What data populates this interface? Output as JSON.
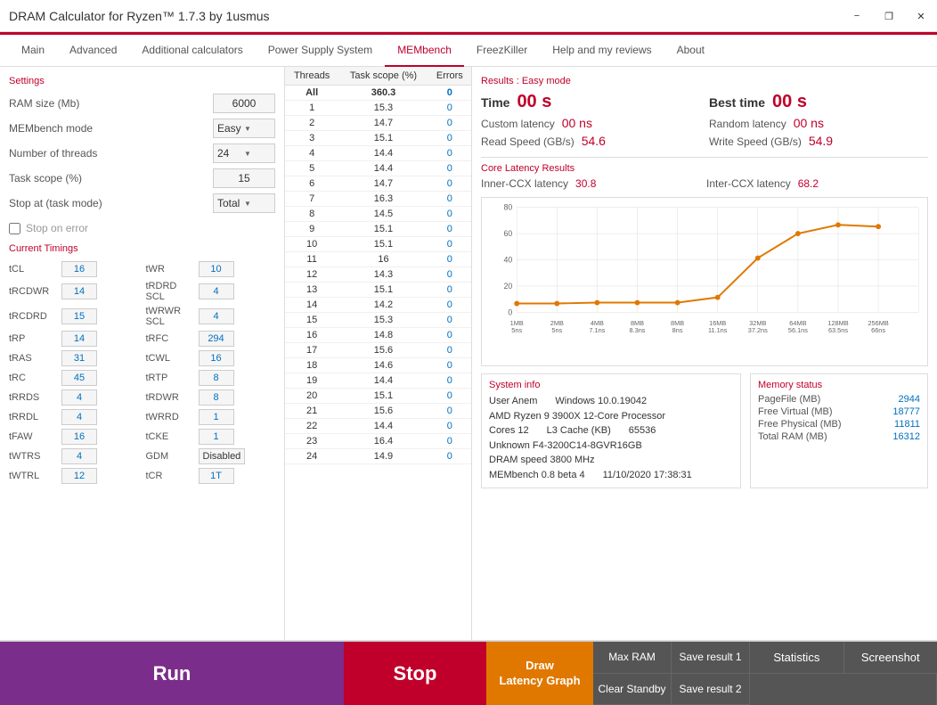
{
  "titlebar": {
    "title": "DRAM Calculator for Ryzen™ 1.7.3 by 1usmus",
    "min": "−",
    "restore": "❐",
    "close": "✕"
  },
  "nav": {
    "items": [
      {
        "label": "Main",
        "active": false
      },
      {
        "label": "Advanced",
        "active": false
      },
      {
        "label": "Additional calculators",
        "active": false
      },
      {
        "label": "Power Supply System",
        "active": false
      },
      {
        "label": "MEMbench",
        "active": true
      },
      {
        "label": "FreezKiller",
        "active": false
      },
      {
        "label": "Help and my reviews",
        "active": false
      },
      {
        "label": "About",
        "active": false
      }
    ]
  },
  "settings": {
    "label": "Settings",
    "ram_size_label": "RAM size (Mb)",
    "ram_size_val": "6000",
    "membench_mode_label": "MEMbench mode",
    "membench_mode_val": "Easy",
    "num_threads_label": "Number of threads",
    "num_threads_val": "24",
    "task_scope_label": "Task scope (%)",
    "task_scope_val": "15",
    "stop_at_label": "Stop at (task mode)",
    "stop_at_val": "Total",
    "stop_on_error_label": "Stop on error"
  },
  "timings": {
    "label": "Current Timings",
    "items": [
      {
        "name": "tCL",
        "val": "16",
        "name2": "tWR",
        "val2": "10"
      },
      {
        "name": "tRCDWR",
        "val": "14",
        "name2": "tRDRD SCL",
        "val2": "4"
      },
      {
        "name": "tRCDRD",
        "val": "15",
        "name2": "tWRWR SCL",
        "val2": "4"
      },
      {
        "name": "tRP",
        "val": "14",
        "name2": "tRFC",
        "val2": "294"
      },
      {
        "name": "tRAS",
        "val": "31",
        "name2": "tCWL",
        "val2": "16"
      },
      {
        "name": "tRC",
        "val": "45",
        "name2": "tRTP",
        "val2": "8"
      },
      {
        "name": "tRRDS",
        "val": "4",
        "name2": "tRDWR",
        "val2": "8"
      },
      {
        "name": "tRRDL",
        "val": "4",
        "name2": "tWRRD",
        "val2": "1"
      },
      {
        "name": "tFAW",
        "val": "16",
        "name2": "tCKE",
        "val2": "1"
      },
      {
        "name": "tWTRS",
        "val": "4",
        "name2": "GDM",
        "val2": "Disabled"
      },
      {
        "name": "tWTRL",
        "val": "12",
        "name2": "tCR",
        "val2": "1T"
      }
    ]
  },
  "bench_table": {
    "headers": [
      "Threads",
      "Task scope (%)",
      "Errors"
    ],
    "rows": [
      {
        "thread": "All",
        "scope": "360.3",
        "errors": "0"
      },
      {
        "thread": "1",
        "scope": "15.3",
        "errors": "0"
      },
      {
        "thread": "2",
        "scope": "14.7",
        "errors": "0"
      },
      {
        "thread": "3",
        "scope": "15.1",
        "errors": "0"
      },
      {
        "thread": "4",
        "scope": "14.4",
        "errors": "0"
      },
      {
        "thread": "5",
        "scope": "14.4",
        "errors": "0"
      },
      {
        "thread": "6",
        "scope": "14.7",
        "errors": "0"
      },
      {
        "thread": "7",
        "scope": "16.3",
        "errors": "0"
      },
      {
        "thread": "8",
        "scope": "14.5",
        "errors": "0"
      },
      {
        "thread": "9",
        "scope": "15.1",
        "errors": "0"
      },
      {
        "thread": "10",
        "scope": "15.1",
        "errors": "0"
      },
      {
        "thread": "11",
        "scope": "16",
        "errors": "0"
      },
      {
        "thread": "12",
        "scope": "14.3",
        "errors": "0"
      },
      {
        "thread": "13",
        "scope": "15.1",
        "errors": "0"
      },
      {
        "thread": "14",
        "scope": "14.2",
        "errors": "0"
      },
      {
        "thread": "15",
        "scope": "15.3",
        "errors": "0"
      },
      {
        "thread": "16",
        "scope": "14.8",
        "errors": "0"
      },
      {
        "thread": "17",
        "scope": "15.6",
        "errors": "0"
      },
      {
        "thread": "18",
        "scope": "14.6",
        "errors": "0"
      },
      {
        "thread": "19",
        "scope": "14.4",
        "errors": "0"
      },
      {
        "thread": "20",
        "scope": "15.1",
        "errors": "0"
      },
      {
        "thread": "21",
        "scope": "15.6",
        "errors": "0"
      },
      {
        "thread": "22",
        "scope": "14.4",
        "errors": "0"
      },
      {
        "thread": "23",
        "scope": "16.4",
        "errors": "0"
      },
      {
        "thread": "24",
        "scope": "14.9",
        "errors": "0"
      }
    ]
  },
  "results": {
    "mode_label": "Results : Easy mode",
    "time_label": "Time",
    "time_val": "00 s",
    "best_time_label": "Best time",
    "best_time_val": "00 s",
    "custom_latency_label": "Custom latency",
    "custom_latency_val": "00 ns",
    "random_latency_label": "Random latency",
    "random_latency_val": "00 ns",
    "read_speed_label": "Read Speed (GB/s)",
    "read_speed_val": "54.6",
    "write_speed_label": "Write Speed (GB/s)",
    "write_speed_val": "54.9",
    "core_latency_label": "Core Latency Results",
    "inner_ccx_label": "Inner-CCX latency",
    "inner_ccx_val": "30.8",
    "inter_ccx_label": "Inter-CCX latency",
    "inter_ccx_val": "68.2"
  },
  "chart": {
    "y_labels": [
      "80",
      "60",
      "40",
      "20",
      "0"
    ],
    "x_labels": [
      "1MB\n5ns",
      "2MB\n5ns",
      "4MB\n7.1ns",
      "8MB\n8.3ns",
      "8MB\n8ns",
      "16MB\n11.1ns",
      "32MB\n37.2ns",
      "64MB\n56.1ns",
      "128MB\n63.5ns",
      "256MB\n66ns"
    ],
    "points": [
      [
        0,
        8
      ],
      [
        1,
        8
      ],
      [
        2,
        8
      ],
      [
        3,
        9
      ],
      [
        4,
        9
      ],
      [
        5,
        12
      ],
      [
        6,
        40
      ],
      [
        7,
        60
      ],
      [
        8,
        67
      ],
      [
        9,
        66
      ]
    ]
  },
  "system_info": {
    "label": "System info",
    "user_label": "User Anem",
    "os": "Windows 10.0.19042",
    "cpu": "AMD Ryzen 9 3900X 12-Core Processor",
    "cores_label": "Cores 12",
    "l3_label": "L3 Cache (KB)",
    "l3_val": "65536",
    "ram": "Unknown F4-3200C14-8GVR16GB",
    "dram_speed": "DRAM speed 3800 MHz",
    "bench": "MEMbench 0.8 beta 4",
    "date": "11/10/2020 17:38:31"
  },
  "memory_status": {
    "label": "Memory status",
    "pagefile_label": "PageFile (MB)",
    "pagefile_val": "2944",
    "free_virtual_label": "Free Virtual (MB)",
    "free_virtual_val": "18777",
    "free_physical_label": "Free Physical (MB)",
    "free_physical_val": "11811",
    "total_ram_label": "Total RAM (MB)",
    "total_ram_val": "16312"
  },
  "toolbar": {
    "run_label": "Run",
    "stop_label": "Stop",
    "draw_label": "Draw\nLatency Graph",
    "max_ram_label": "Max RAM",
    "clear_standby_label": "Clear Standby",
    "save_result1_label": "Save result 1",
    "save_result2_label": "Save result 2",
    "statistics_label": "Statistics",
    "screenshot_label": "Screenshot"
  }
}
